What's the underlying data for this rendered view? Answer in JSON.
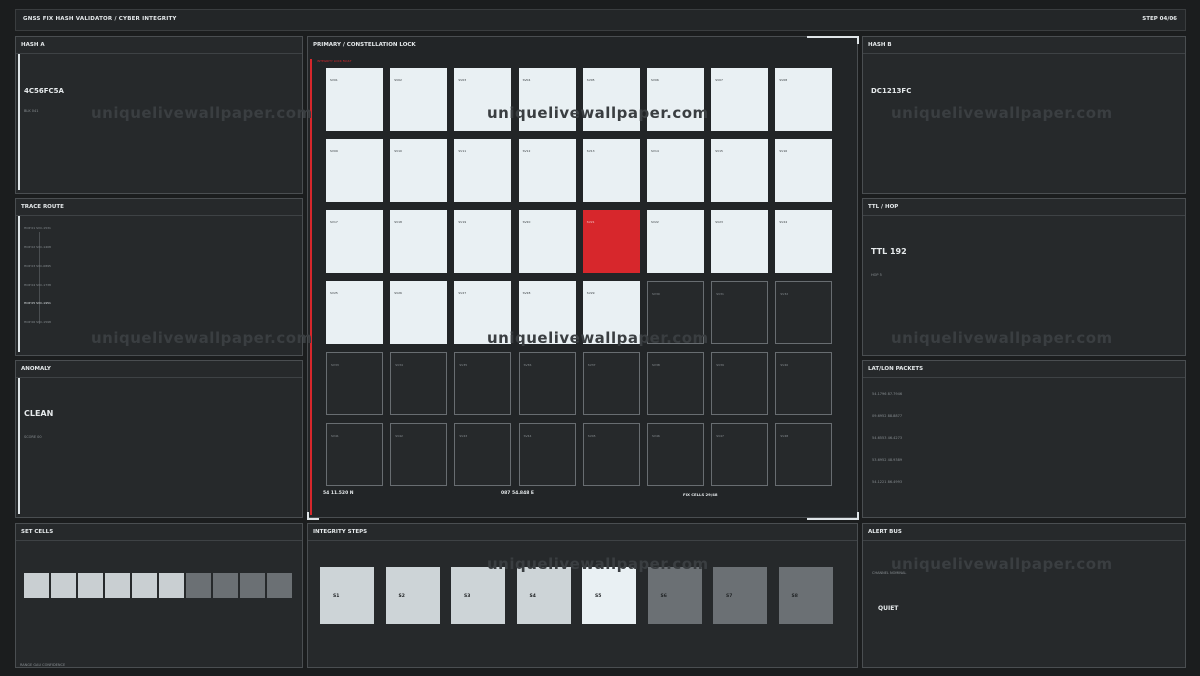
{
  "header": {
    "title": "GNSS FIX HASH VALIDATOR  /  CYBER INTEGRITY",
    "step": "STEP 04/06"
  },
  "hash_a": {
    "title": "HASH A",
    "value": "4C56FC5A",
    "sub": "BLK 041"
  },
  "hash_b": {
    "title": "HASH B",
    "value": "DC1213FC"
  },
  "trace": {
    "title": "TRACE ROUTE",
    "hops": [
      "HOP 01  SVC-1531",
      "HOP 02  SVC-1408",
      "HOP 03  SVC-0895",
      "HOP 04  SVC-1738",
      "HOP 05  SVC-1951",
      "HOP 06  SVC-1598"
    ]
  },
  "anomaly": {
    "title": "ANOMALY",
    "value": "CLEAN",
    "sub": "SCORE 00"
  },
  "ttl": {
    "title": "TTL / HOP",
    "value": "TTL 192",
    "sub": "HOP 5"
  },
  "latlon": {
    "title": "LAT/LON PACKETS",
    "packets": [
      "54.1796  87.7946",
      "09.6952  88.8877",
      "54.6553  46.4273",
      "53.6952  48.9389",
      "54.1221  86.4993"
    ]
  },
  "main": {
    "title": "PRIMARY  /  CONSTELLATION LOCK",
    "alert_text": "INTEGRITY LOCK FAULT",
    "cells": [
      {
        "id": "SV01",
        "state": "lit"
      },
      {
        "id": "SV02",
        "state": "lit"
      },
      {
        "id": "SV03",
        "state": "lit"
      },
      {
        "id": "SV04",
        "state": "lit"
      },
      {
        "id": "SV05",
        "state": "lit"
      },
      {
        "id": "SV06",
        "state": "lit"
      },
      {
        "id": "SV07",
        "state": "lit"
      },
      {
        "id": "SV08",
        "state": "lit"
      },
      {
        "id": "SV09",
        "state": "lit"
      },
      {
        "id": "SV10",
        "state": "lit"
      },
      {
        "id": "SV11",
        "state": "lit"
      },
      {
        "id": "SV12",
        "state": "lit"
      },
      {
        "id": "SV13",
        "state": "lit"
      },
      {
        "id": "SV14",
        "state": "lit"
      },
      {
        "id": "SV15",
        "state": "lit"
      },
      {
        "id": "SV16",
        "state": "lit"
      },
      {
        "id": "SV17",
        "state": "lit"
      },
      {
        "id": "SV18",
        "state": "lit"
      },
      {
        "id": "SV19",
        "state": "lit"
      },
      {
        "id": "SV20",
        "state": "lit"
      },
      {
        "id": "SV21",
        "state": "alert"
      },
      {
        "id": "SV22",
        "state": "lit"
      },
      {
        "id": "SV23",
        "state": "lit"
      },
      {
        "id": "SV24",
        "state": "lit"
      },
      {
        "id": "SV25",
        "state": "lit"
      },
      {
        "id": "SV26",
        "state": "lit"
      },
      {
        "id": "SV27",
        "state": "lit"
      },
      {
        "id": "SV28",
        "state": "lit"
      },
      {
        "id": "SV29",
        "state": "lit"
      },
      {
        "id": "SV30",
        "state": "off"
      },
      {
        "id": "SV31",
        "state": "off"
      },
      {
        "id": "SV32",
        "state": "off"
      },
      {
        "id": "SV33",
        "state": "off"
      },
      {
        "id": "SV34",
        "state": "off"
      },
      {
        "id": "SV35",
        "state": "off"
      },
      {
        "id": "SV36",
        "state": "off"
      },
      {
        "id": "SV37",
        "state": "off"
      },
      {
        "id": "SV38",
        "state": "off"
      },
      {
        "id": "SV39",
        "state": "off"
      },
      {
        "id": "SV40",
        "state": "off"
      },
      {
        "id": "SV41",
        "state": "off"
      },
      {
        "id": "SV42",
        "state": "off"
      },
      {
        "id": "SV43",
        "state": "off"
      },
      {
        "id": "SV44",
        "state": "off"
      },
      {
        "id": "SV45",
        "state": "off"
      },
      {
        "id": "SV46",
        "state": "off"
      },
      {
        "id": "SV47",
        "state": "off"
      },
      {
        "id": "SV48",
        "state": "off"
      }
    ],
    "footer": {
      "lat": "54 11.520 N",
      "lon": "087 54.848 E",
      "fix": "FIX CELLS 29/48"
    }
  },
  "set_cells": {
    "title": "SET CELLS",
    "footer": "RANGE GAU  CONFIDENCE",
    "cells": [
      {
        "color": "#c9cfd2"
      },
      {
        "color": "#c9cfd2"
      },
      {
        "color": "#c9cfd2"
      },
      {
        "color": "#c9cfd2"
      },
      {
        "color": "#c9cfd2"
      },
      {
        "color": "#c9cfd2"
      },
      {
        "color": "#6b7074"
      },
      {
        "color": "#6b7074"
      },
      {
        "color": "#6b7074"
      },
      {
        "color": "#6b7074"
      }
    ]
  },
  "integrity": {
    "title": "INTEGRITY STEPS",
    "steps": [
      {
        "label": "S1",
        "color": "#cdd4d7"
      },
      {
        "label": "S2",
        "color": "#cdd4d7"
      },
      {
        "label": "S3",
        "color": "#cdd4d7"
      },
      {
        "label": "S4",
        "color": "#cdd4d7"
      },
      {
        "label": "S5",
        "color": "#e9f0f3"
      },
      {
        "label": "S6",
        "color": "#6b7074"
      },
      {
        "label": "S7",
        "color": "#6b7074"
      },
      {
        "label": "S8",
        "color": "#6b7074"
      }
    ]
  },
  "alert_bus": {
    "title": "ALERT BUS",
    "sub": "CHANNEL NOMINAL",
    "status": "QUIET"
  },
  "watermark": "uniquelivewallpaper.com"
}
